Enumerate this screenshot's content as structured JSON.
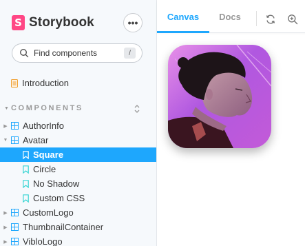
{
  "brand": {
    "name": "Storybook",
    "badge_letter": "S",
    "color": "#ff4785"
  },
  "sidebar": {
    "more_label": "•••",
    "search": {
      "placeholder": "Find components",
      "shortcut": "/"
    },
    "intro": {
      "label": "Introduction"
    },
    "section": {
      "title": "COMPONENTS"
    },
    "tree": [
      {
        "label": "AuthorInfo",
        "expanded": false
      },
      {
        "label": "Avatar",
        "expanded": true,
        "stories": [
          {
            "label": "Square",
            "selected": true
          },
          {
            "label": "Circle",
            "selected": false
          },
          {
            "label": "No Shadow",
            "selected": false
          },
          {
            "label": "Custom CSS",
            "selected": false
          }
        ]
      },
      {
        "label": "CustomLogo",
        "expanded": false
      },
      {
        "label": "ThumbnailContainer",
        "expanded": false
      },
      {
        "label": "VibloLogo",
        "expanded": false
      }
    ],
    "accent": "#1ea7fd"
  },
  "toolbar": {
    "tabs": [
      {
        "label": "Canvas",
        "active": true
      },
      {
        "label": "Docs",
        "active": false
      }
    ],
    "icons": [
      "refresh-icon",
      "zoom-in-icon"
    ]
  },
  "canvas": {
    "preview": "avatar-square-photo"
  }
}
